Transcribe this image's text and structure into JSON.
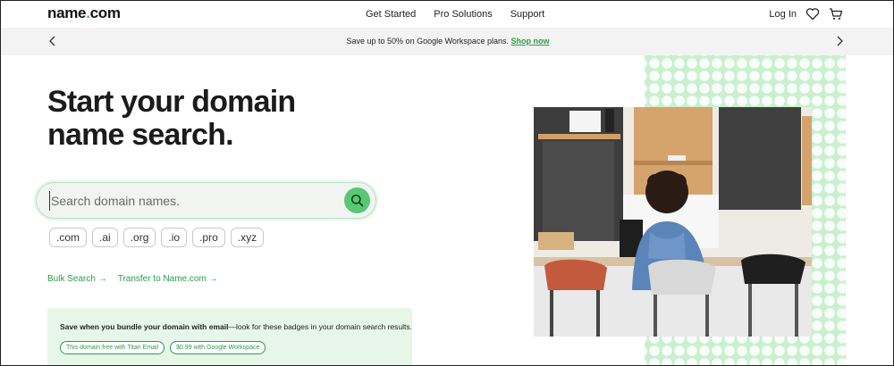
{
  "header": {
    "logo_main": "name",
    "logo_dot": ".",
    "logo_tld": "com",
    "nav": [
      "Get Started",
      "Pro Solutions",
      "Support"
    ],
    "login": "Log In"
  },
  "promo": {
    "text": "Save up to 50% on Google Workspace plans.",
    "link": "Shop now"
  },
  "hero": {
    "title_line1": "Start your domain",
    "title_line2": "name search."
  },
  "search": {
    "placeholder": "Search domain names."
  },
  "tlds": [
    ".com",
    ".ai",
    ".org",
    ".io",
    ".pro",
    ".xyz"
  ],
  "links": {
    "bulk": "Bulk Search →",
    "transfer": "Transfer to Name.com →"
  },
  "bundle": {
    "bold": "Save when you bundle your domain with email",
    "rest": "—look for these badges in your domain search results.",
    "badges": [
      "This domain free with Titan Email",
      "$0.99 with Google Workspace"
    ]
  },
  "colors": {
    "accent": "#4cbf6a",
    "link": "#2a9d48",
    "bundle_bg": "#e6f6e9",
    "promo_bg": "#f3f3f3"
  },
  "icons": [
    "heart-icon",
    "cart-icon",
    "chevron-left-icon",
    "chevron-right-icon",
    "search-icon"
  ]
}
